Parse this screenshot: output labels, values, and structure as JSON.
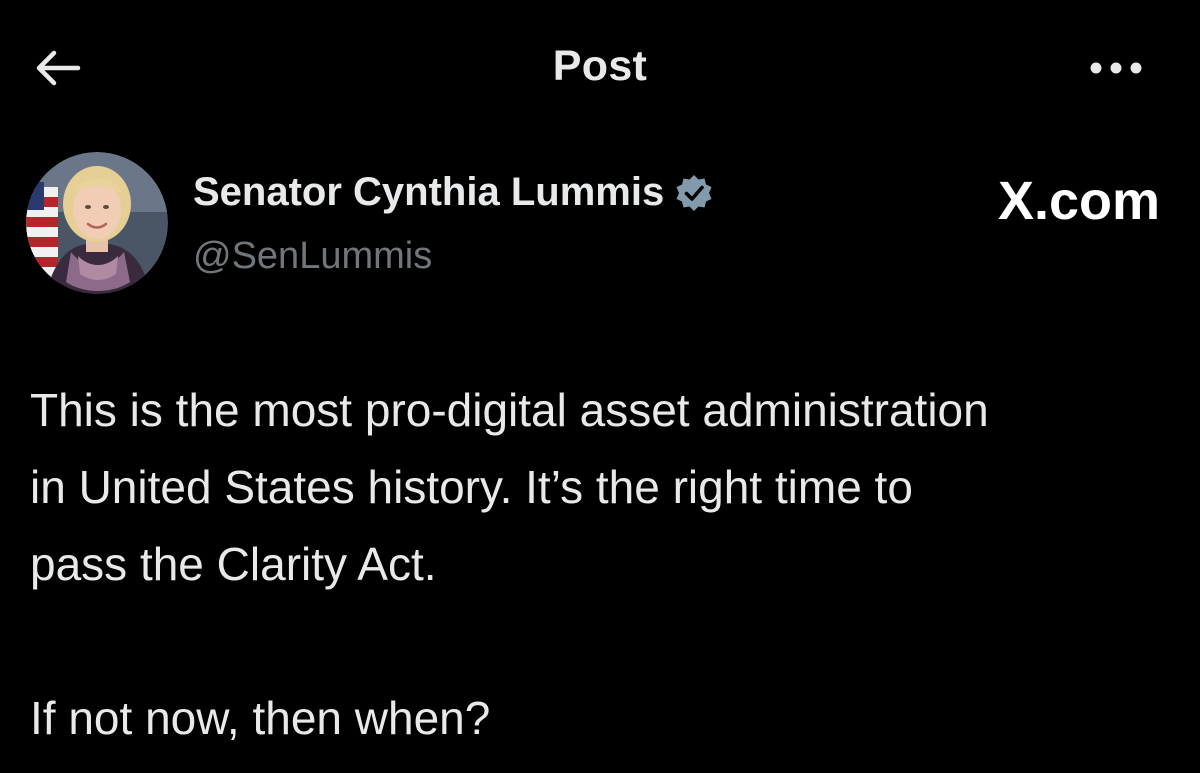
{
  "header": {
    "title": "Post",
    "back_icon": "arrow-left-icon",
    "more_icon": "more-horizontal-icon"
  },
  "author": {
    "name": "Senator Cynthia Lummis",
    "handle": "@SenLummis",
    "verified": true,
    "verified_badge_color": "#829aab",
    "avatar_icon": "profile-photo"
  },
  "watermark": {
    "text": "X.com",
    "icon": "x-logo"
  },
  "post": {
    "lines": [
      "This is the most pro-digital asset administration",
      "in United States history. It’s the right time to",
      "pass the Clarity Act.",
      "If not now, then when?"
    ]
  },
  "colors": {
    "background": "#000000",
    "primary_text": "#e7e9ea",
    "secondary_text": "#71767b"
  }
}
